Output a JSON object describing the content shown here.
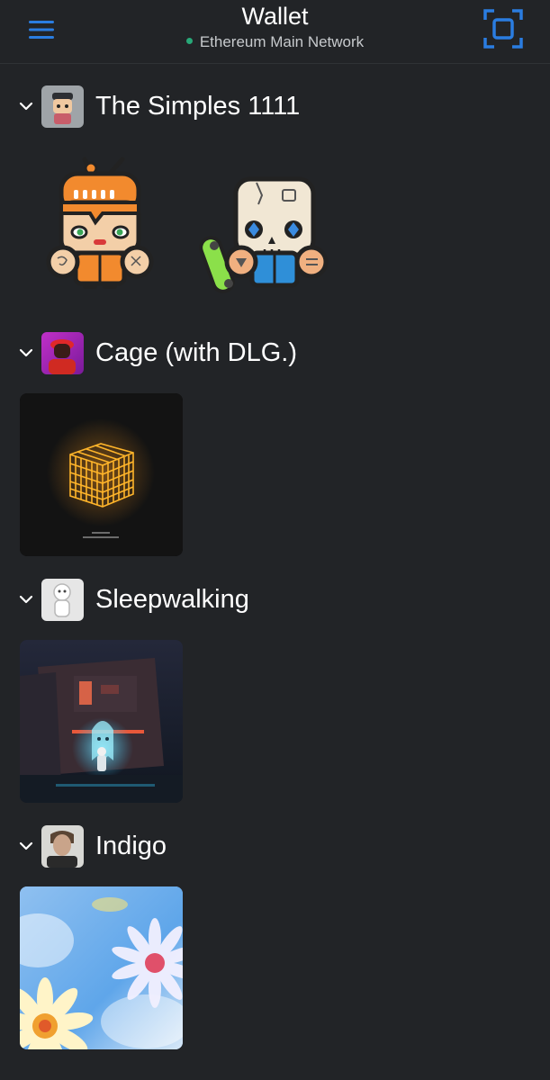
{
  "header": {
    "title": "Wallet",
    "network": "Ethereum Main Network",
    "network_status_color": "#28a878",
    "accent_color": "#2a7de1"
  },
  "collections": [
    {
      "name": "The Simples 1111",
      "icon": "simples-avatar",
      "items": [
        {
          "label": "orange-haired simple character nft"
        },
        {
          "label": "skull simple character with skateboard nft"
        }
      ]
    },
    {
      "name": "Cage (with DLG.)",
      "icon": "magenta-portrait",
      "items": [
        {
          "label": "glowing orange cage cube nft"
        }
      ]
    },
    {
      "name": "Sleepwalking",
      "icon": "white-figure",
      "items": [
        {
          "label": "ghost figure neon street nft"
        }
      ]
    },
    {
      "name": "Indigo",
      "icon": "man-portrait",
      "items": [
        {
          "label": "daisy flowers sky nft"
        }
      ]
    }
  ]
}
